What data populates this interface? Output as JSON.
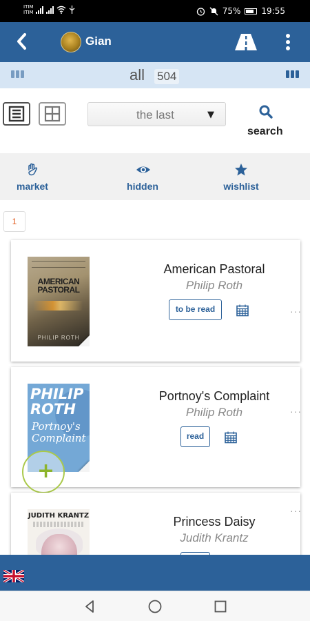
{
  "status_bar": {
    "carrier_1": "ITIM",
    "carrier_2": "ITIM",
    "battery": "75%",
    "time": "19:55"
  },
  "header": {
    "user_name": "Gian",
    "icons": [
      "back-arrow-icon",
      "road-icon",
      "more-vertical-icon"
    ]
  },
  "count_bar": {
    "label": "all",
    "count": "504"
  },
  "toolbar": {
    "sort_value": "the last",
    "search_label": "search",
    "icons": [
      "list-view-icon",
      "grid-view-icon",
      "search-icon"
    ]
  },
  "filters": [
    {
      "label": "market",
      "icon": "hand-icon"
    },
    {
      "label": "hidden",
      "icon": "eye-icon"
    },
    {
      "label": "wishlist",
      "icon": "star-icon"
    }
  ],
  "pagination": {
    "current_page": "1"
  },
  "books": [
    {
      "title": "American Pastoral",
      "author": "Philip Roth",
      "status": "to be read",
      "cover_title": "AMERICAN PASTORAL",
      "cover_author": "PHILIP ROTH"
    },
    {
      "title": "Portnoy's Complaint",
      "author": "Philip Roth",
      "status": "read",
      "cover_title": "PHILIP ROTH",
      "cover_subtitle": "Portnoy's Complaint"
    },
    {
      "title": "Princess Daisy",
      "author": "Judith Krantz",
      "status": "",
      "cover_author": "JUDITH KRANTZ"
    }
  ],
  "colors": {
    "primary": "#2c6199",
    "count_bar": "#d6e5f4",
    "filter_bar": "#f1f1f1",
    "page_number": "#e25a1c",
    "add_button": "#8db42b"
  },
  "footer": {
    "language_icon": "uk-flag-icon"
  },
  "nav_bar": {
    "icons": [
      "back-triangle-icon",
      "home-circle-icon",
      "recents-square-icon"
    ]
  }
}
